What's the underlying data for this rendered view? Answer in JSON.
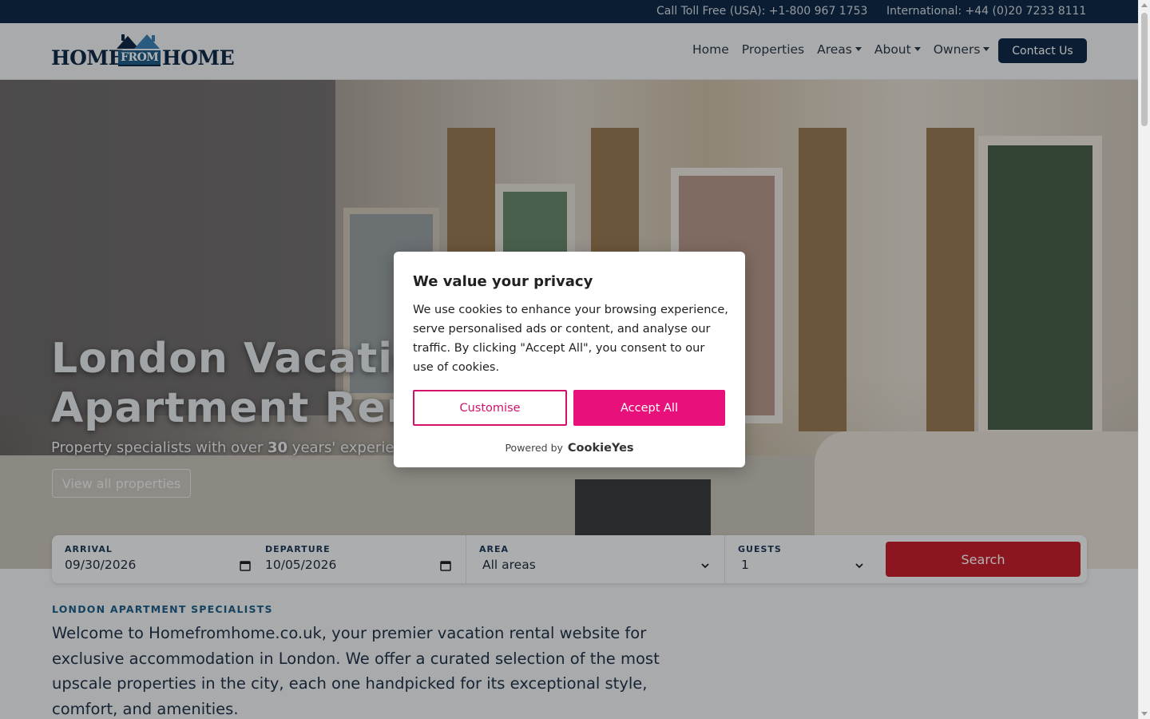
{
  "topbar": {
    "toll_free": "Call Toll Free (USA): +1-800 967 1753",
    "international": "International: +44 (0)20 7233 8111"
  },
  "logo": {
    "word1": "HOME",
    "word2": "FROM",
    "word3": "HOME"
  },
  "nav": {
    "home": "Home",
    "properties": "Properties",
    "areas": "Areas",
    "about": "About",
    "owners": "Owners",
    "contact": "Contact Us"
  },
  "hero": {
    "title_line1": "London Vacation",
    "title_line2": "Apartment Rentals",
    "subtitle_pre": "Property specialists with over ",
    "subtitle_num": "30",
    "subtitle_post": " years' experience",
    "button": "View all properties"
  },
  "search": {
    "arrival_label": "ARRIVAL",
    "arrival_value": "09/30/2026",
    "departure_label": "DEPARTURE",
    "departure_value": "10/05/2026",
    "area_label": "AREA",
    "area_value": "All areas",
    "guests_label": "GUESTS",
    "guests_value": "1",
    "button": "Search"
  },
  "intro": {
    "eyebrow": "LONDON APARTMENT SPECIALISTS",
    "text": "Welcome to Homefromhome.co.uk, your premier vacation rental website for exclusive accommodation in London. We offer a curated selection of the most upscale properties in the city, each one handpicked for its exceptional style, comfort, and amenities."
  },
  "cookie": {
    "title": "We value your privacy",
    "body": "We use cookies to enhance your browsing experience, serve personalised ads or content, and analyse our traffic. By clicking \"Accept All\", you consent to our use of cookies.",
    "customise": "Customise",
    "accept": "Accept All",
    "powered_by": "Powered by",
    "brand": "CookieYes"
  },
  "colors": {
    "navy": "#0f2a4a",
    "search_red": "#c8202f",
    "cookie_pink": "#e8107a"
  }
}
